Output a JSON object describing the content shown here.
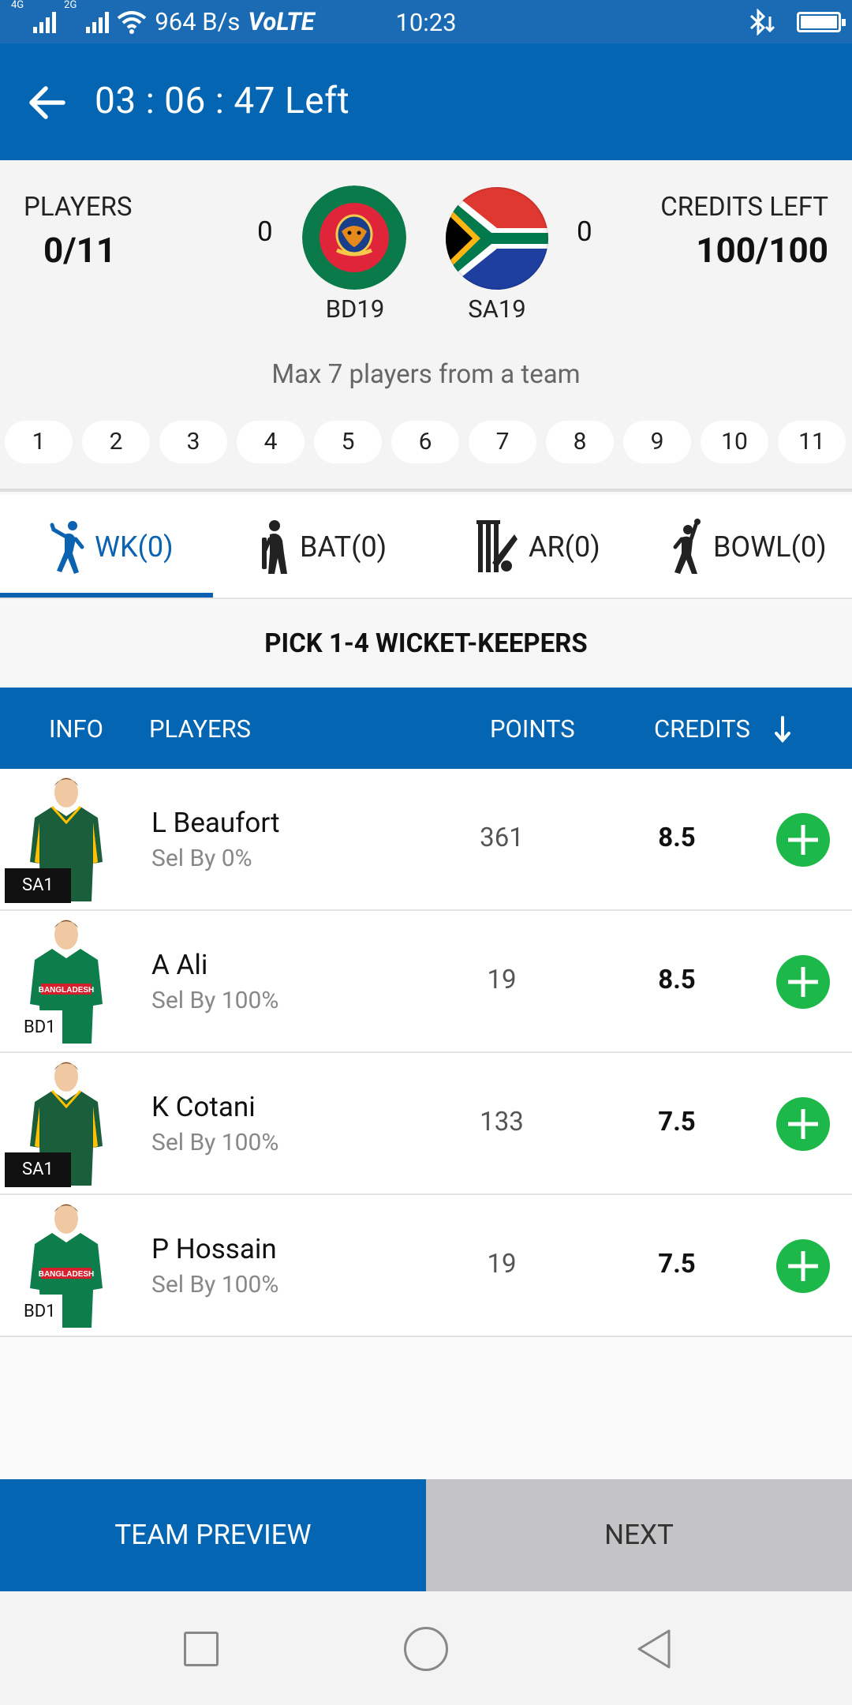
{
  "status_bar": {
    "net1": "4G",
    "net2": "2G",
    "speed": "964 B/s",
    "volte": "VoLTE",
    "time": "10:23"
  },
  "header": {
    "timer": "03 : 06 : 47 Left"
  },
  "summary": {
    "players_label": "PLAYERS",
    "players_value": "0/11",
    "credits_label": "CREDITS LEFT",
    "credits_value": "100/100",
    "team1_count": "0",
    "team2_count": "0",
    "team1": "BD19",
    "team2": "SA19",
    "max_note": "Max 7 players from a team",
    "slots": [
      "1",
      "2",
      "3",
      "4",
      "5",
      "6",
      "7",
      "8",
      "9",
      "10",
      "11"
    ]
  },
  "tabs": [
    {
      "label": "WK(0)",
      "icon": "wicketkeeper-icon"
    },
    {
      "label": "BAT(0)",
      "icon": "batsman-icon"
    },
    {
      "label": "AR(0)",
      "icon": "allrounder-icon"
    },
    {
      "label": "BOWL(0)",
      "icon": "bowler-icon"
    }
  ],
  "pick_hint": "PICK 1-4 WICKET-KEEPERS",
  "table_header": {
    "info": "INFO",
    "players": "PLAYERS",
    "points": "POINTS",
    "credits": "CREDITS"
  },
  "players": [
    {
      "name": "L Beaufort",
      "sel": "Sel By 0%",
      "points": "361",
      "credits": "8.5",
      "team": "SA1"
    },
    {
      "name": "A Ali",
      "sel": "Sel By 100%",
      "points": "19",
      "credits": "8.5",
      "team": "BD1"
    },
    {
      "name": "K Cotani",
      "sel": "Sel By 100%",
      "points": "133",
      "credits": "7.5",
      "team": "SA1"
    },
    {
      "name": "P Hossain",
      "sel": "Sel By 100%",
      "points": "19",
      "credits": "7.5",
      "team": "BD1"
    }
  ],
  "jersey_text": "BANGLADESH",
  "footer": {
    "preview": "TEAM PREVIEW",
    "next": "NEXT"
  },
  "colors": {
    "primary": "#0465b3",
    "add": "#1db84a"
  }
}
